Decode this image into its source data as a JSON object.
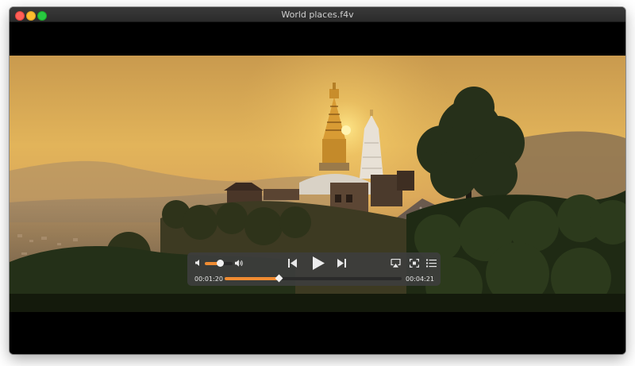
{
  "window": {
    "title": "World places.f4v"
  },
  "player": {
    "current_time": "00:01:20",
    "total_time": "00:04:21",
    "progress_fraction": 0.306,
    "volume_fraction": 0.55,
    "accent_color": "#f08c32"
  },
  "icons": {
    "close": "close-icon",
    "minimize": "minimize-icon",
    "maximize": "maximize-icon",
    "volume_low": "volume-low-icon",
    "volume_high": "volume-high-icon",
    "previous": "skip-previous-icon",
    "play": "play-icon",
    "next": "skip-next-icon",
    "airplay": "airplay-icon",
    "fullscreen": "fullscreen-icon",
    "playlist": "playlist-icon"
  }
}
